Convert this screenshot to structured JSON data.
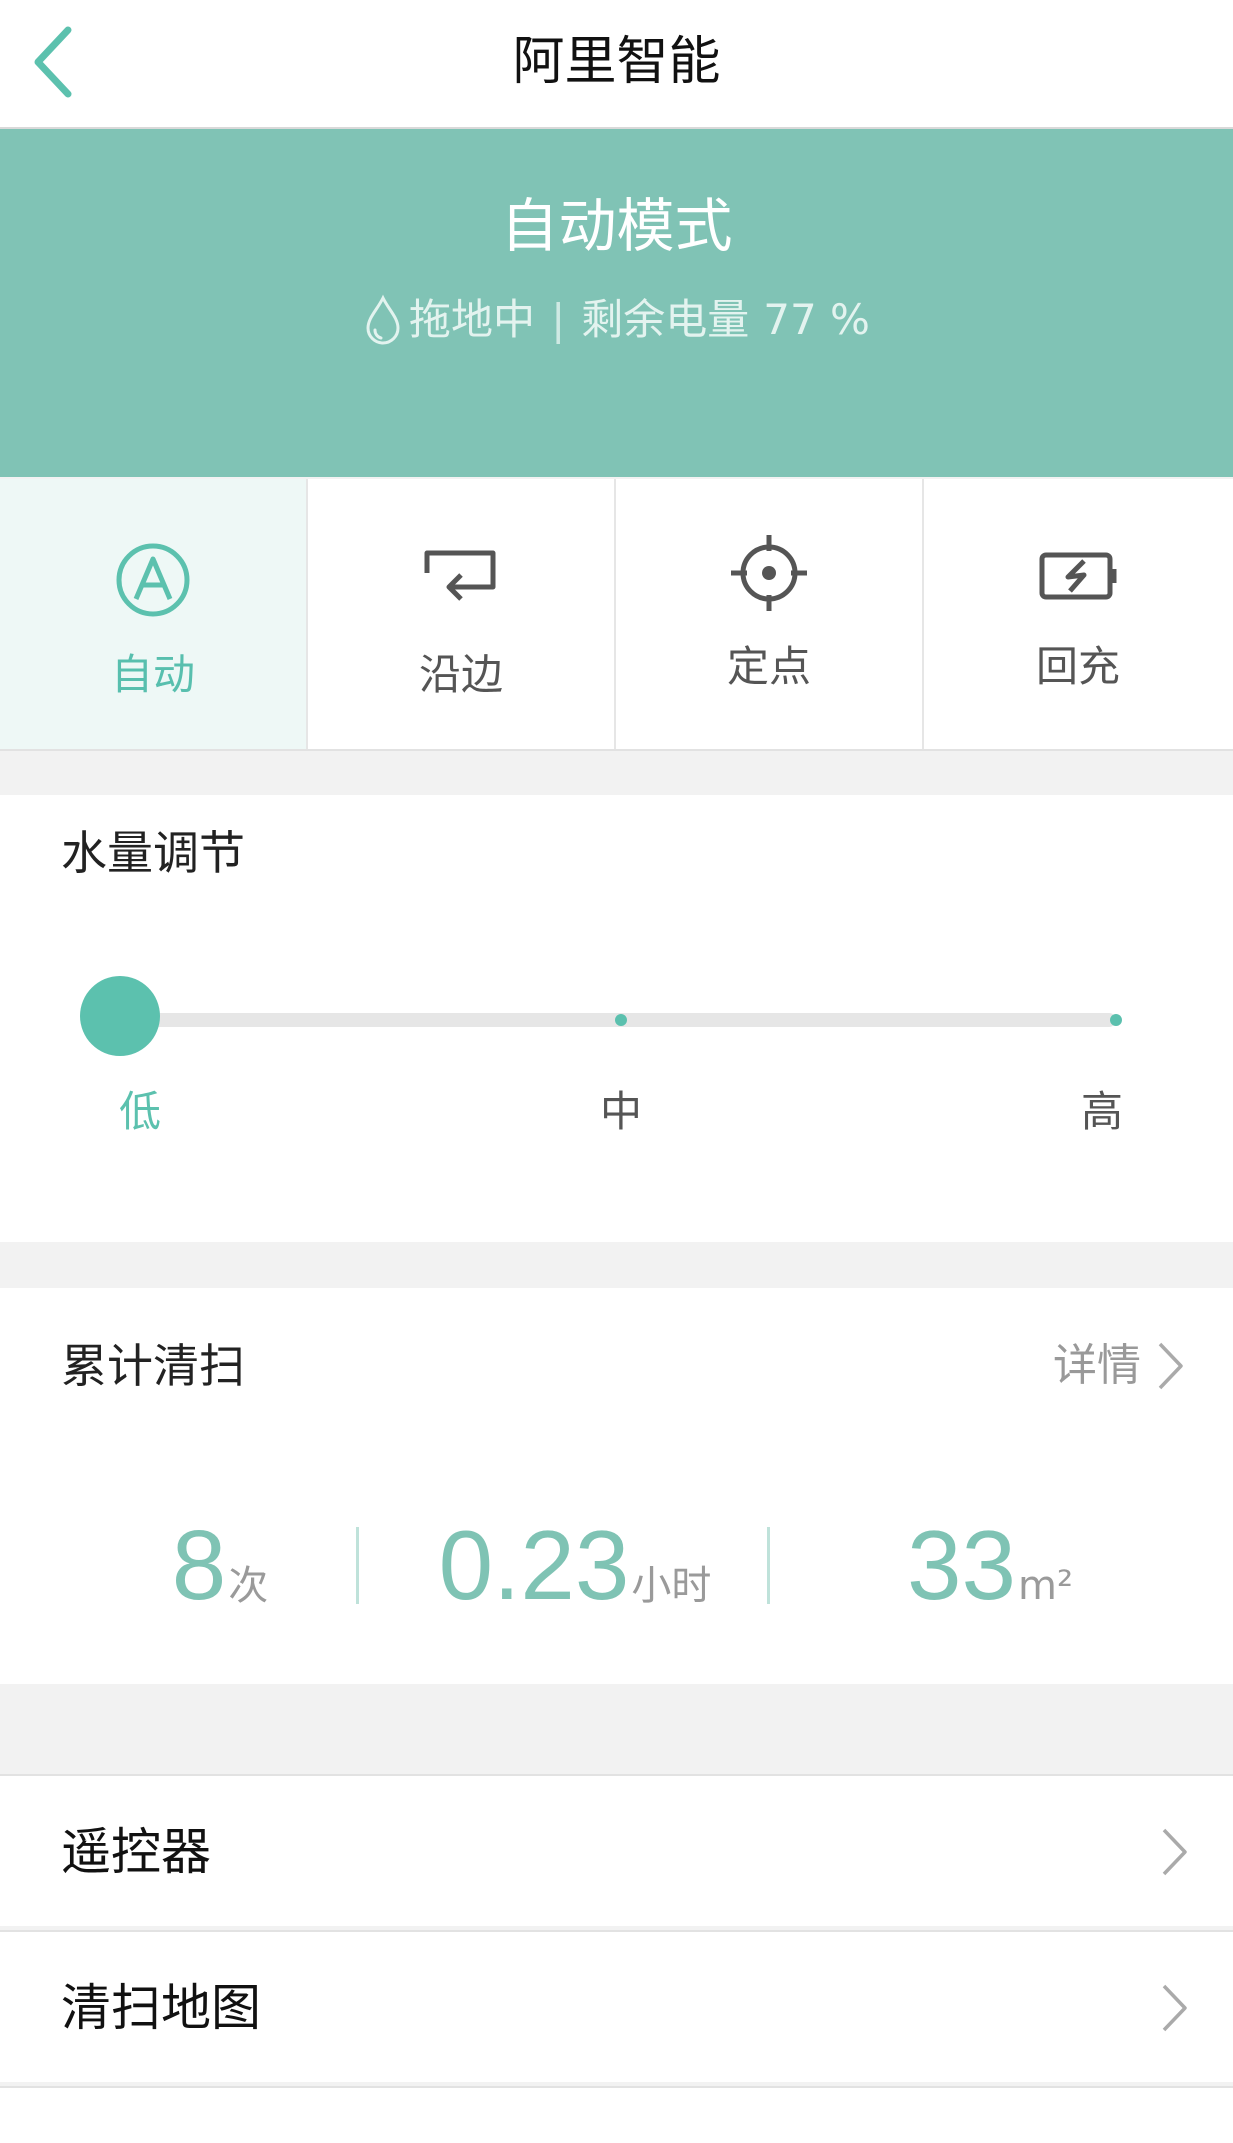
{
  "nav": {
    "title": "阿里智能"
  },
  "status": {
    "mode_title": "自动模式",
    "activity": "拖地中",
    "battery_label": "剩余电量",
    "battery_value": "77 %"
  },
  "modes": [
    {
      "label": "自动",
      "icon": "auto-mode-icon",
      "active": true
    },
    {
      "label": "沿边",
      "icon": "edge-mode-icon",
      "active": false
    },
    {
      "label": "定点",
      "icon": "spot-mode-icon",
      "active": false
    },
    {
      "label": "回充",
      "icon": "recharge-icon",
      "active": false
    }
  ],
  "water": {
    "title": "水量调节",
    "levels": [
      "低",
      "中",
      "高"
    ],
    "selected_index": 0
  },
  "stats": {
    "title": "累计清扫",
    "detail_label": "详情",
    "count": {
      "value": "8",
      "unit": "次"
    },
    "hours": {
      "value": "0.23",
      "unit": "小时"
    },
    "area": {
      "value": "33",
      "unit": "m²"
    }
  },
  "list": {
    "remote": "遥控器",
    "map": "清扫地图"
  },
  "colors": {
    "accent": "#5cc1ae",
    "header_bg": "#80c3b5",
    "active_tile_bg": "#eef8f6"
  }
}
